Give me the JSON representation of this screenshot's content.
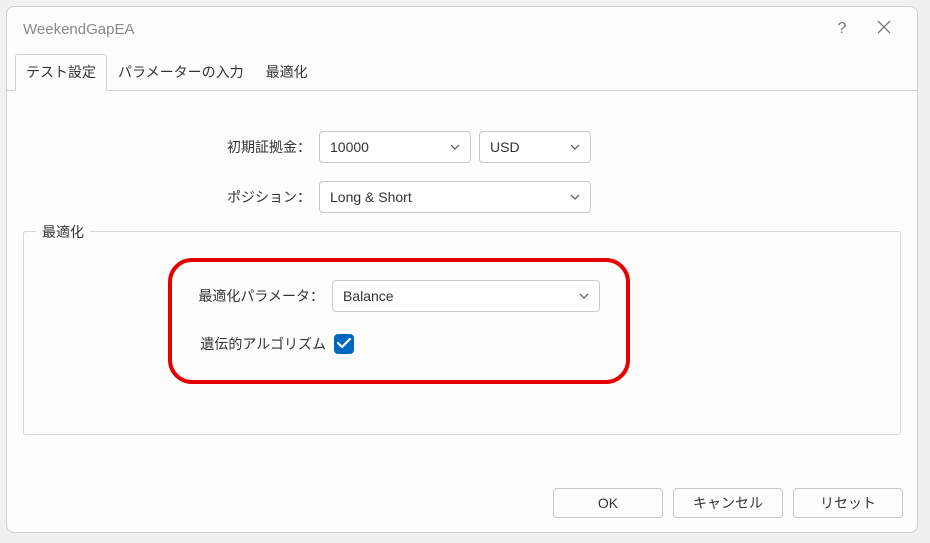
{
  "window": {
    "title": "WeekendGapEA"
  },
  "tabs": {
    "test_settings": "テスト設定",
    "param_input": "パラメーターの入力",
    "optimization": "最適化"
  },
  "form": {
    "initial_margin_label": "初期証拠金：",
    "initial_margin_value": "10000",
    "currency_value": "USD",
    "position_label": "ポジション：",
    "position_value": "Long & Short"
  },
  "opt": {
    "group_label": "最適化",
    "param_label": "最適化パラメータ：",
    "param_value": "Balance",
    "genetic_label": "遺伝的アルゴリズム",
    "genetic_checked": true
  },
  "buttons": {
    "ok": "OK",
    "cancel": "キャンセル",
    "reset": "リセット"
  }
}
